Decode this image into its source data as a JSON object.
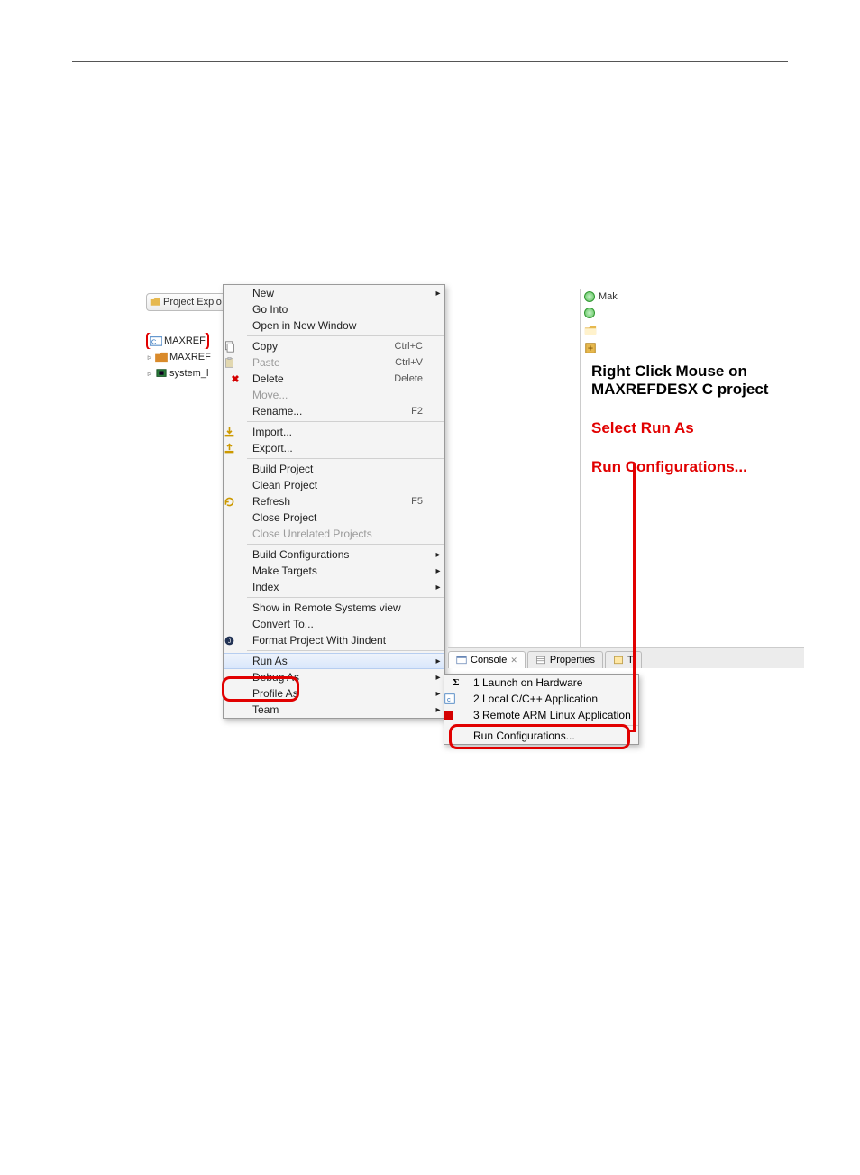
{
  "explorer": {
    "tab_label": "Project Explo",
    "items": [
      {
        "label": "MAXREF",
        "icon": "c-project"
      },
      {
        "label": "MAXREF",
        "icon": "folder-orange"
      },
      {
        "label": "system_l",
        "icon": "hw-chip"
      }
    ]
  },
  "context_menu": [
    {
      "label": "New",
      "arrow": true
    },
    {
      "label": "Go Into"
    },
    {
      "label": "Open in New Window"
    },
    {
      "sep": true
    },
    {
      "label": "Copy",
      "shortcut": "Ctrl+C",
      "icon": "copy"
    },
    {
      "label": "Paste",
      "shortcut": "Ctrl+V",
      "icon": "paste",
      "disabled": true
    },
    {
      "label": "Delete",
      "shortcut": "Delete",
      "icon": "delete"
    },
    {
      "label": "Move...",
      "disabled": true
    },
    {
      "label": "Rename...",
      "shortcut": "F2"
    },
    {
      "sep": true
    },
    {
      "label": "Import...",
      "icon": "import"
    },
    {
      "label": "Export...",
      "icon": "export"
    },
    {
      "sep": true
    },
    {
      "label": "Build Project"
    },
    {
      "label": "Clean Project"
    },
    {
      "label": "Refresh",
      "shortcut": "F5",
      "icon": "refresh"
    },
    {
      "label": "Close Project"
    },
    {
      "label": "Close Unrelated Projects",
      "disabled": true
    },
    {
      "sep": true
    },
    {
      "label": "Build Configurations",
      "arrow": true
    },
    {
      "label": "Make Targets",
      "arrow": true
    },
    {
      "label": "Index",
      "arrow": true
    },
    {
      "sep": true
    },
    {
      "label": "Show in Remote Systems view"
    },
    {
      "label": "Convert To..."
    },
    {
      "label": "Format Project With Jindent",
      "icon": "jindent"
    },
    {
      "sep": true
    },
    {
      "label": "Run As",
      "arrow": true,
      "highlight": true
    },
    {
      "label": "Debug As",
      "arrow": true
    },
    {
      "label": "Profile As",
      "arrow": true
    },
    {
      "label": "Team",
      "arrow": true
    }
  ],
  "submenu": [
    {
      "label": "1 Launch on Hardware",
      "icon": "sigma"
    },
    {
      "label": "2 Local C/C++ Application",
      "icon": "c-app"
    },
    {
      "label": "3 Remote ARM Linux Application",
      "icon": "red-sq"
    },
    {
      "sep": true
    },
    {
      "label": "Run Configurations..."
    }
  ],
  "right_stubs": {
    "make_label": "Mak"
  },
  "pane_controls": "▭ ▭",
  "bottom_tabs": {
    "console": "Console",
    "close_glyph": "✕",
    "properties": "Properties",
    "trail": "T"
  },
  "annotations": {
    "line1_red": "Right Click Mouse",
    "line1_black": " on",
    "line2": "MAXREFDESX C project",
    "line3": "Select Run As",
    "line4": "Run Configurations..."
  }
}
